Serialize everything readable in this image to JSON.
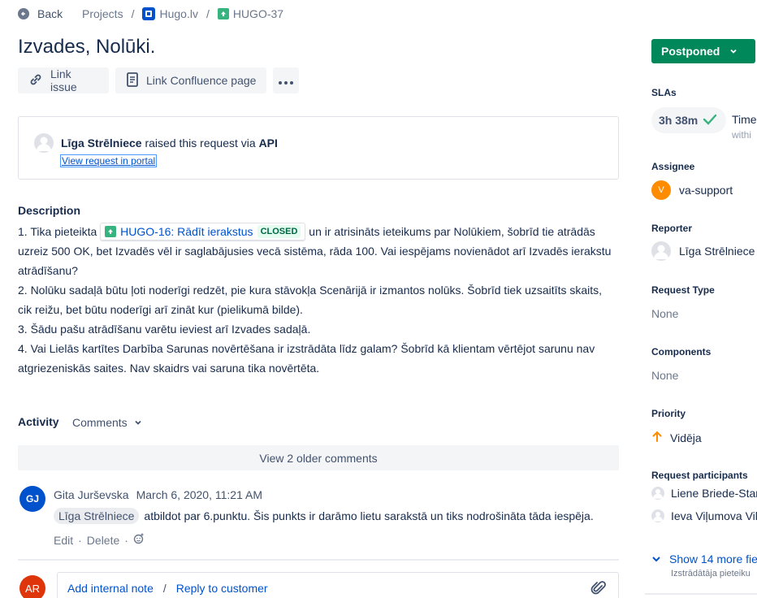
{
  "nav": {
    "back_label": "Back",
    "breadcrumbs": [
      "Projects",
      "Hugo.lv",
      "HUGO-37"
    ],
    "separator": "/"
  },
  "issue": {
    "title": "Izvades, Nolūki.",
    "status": "Postponed"
  },
  "actions": {
    "link_issue": "Link issue",
    "link_confluence": "Link Confluence page"
  },
  "request": {
    "raiser": "Līga Strēlniece",
    "raised_text": "raised this request via",
    "channel": "API",
    "portal_link": "View request in portal"
  },
  "description": {
    "heading": "Description",
    "p1_before": "1. Tika pieteikta ",
    "linked_issue": "HUGO-16: Rādīt ierakstus",
    "linked_status": "CLOSED",
    "p1_after": " un ir atrisināts ieteikums par Nolūkiem, šobrīd tie atrādās uzreiz 500 OK, bet Izvadēs vēl ir saglabājusies vecā sistēma, rāda 100. Vai iespējams novienādot arī Izvadēs ierakstu atrādīšanu?",
    "p2": "2. Nolūku sadaļā būtu ļoti noderīgi redzēt, pie kura stāvokļa Scenārijā ir izmantos nolūks. Šobrīd tiek uzsaitīts skaits, cik reižu, bet būtu noderīgi arī zināt kur (pielikumā bilde).",
    "p3": "3. Šādu pašu atrādīšanu varētu ieviest arī Izvades sadaļā.",
    "p4": "4. Vai Lielās kartītes Darbība Sarunas novērtēšana ir izstrādāta līdz galam? Šobrīd kā klientam vērtējot sarunu nav atgriezeniskās saites. Nav skaidrs vai saruna tika novērtēta."
  },
  "activity": {
    "heading": "Activity",
    "filter": "Comments",
    "older_comments": "View 2 older comments",
    "comment": {
      "initials": "GJ",
      "author": "Gita Jurševska",
      "timestamp": "March 6, 2020, 11:21 AM",
      "mention": "Līga Strēlniece",
      "text": "atbildot par 6.punktu. Šis punkts ir darāmo lietu sarakstā un tiks nodrošināta tāda iespēja.",
      "edit": "Edit",
      "delete": "Delete",
      "dot": "·"
    },
    "composer": {
      "initials": "AR",
      "add_internal": "Add internal note",
      "separator": "/",
      "reply": "Reply to customer"
    }
  },
  "sidebar": {
    "slas_label": "SLAs",
    "sla_value": "3h 38m",
    "sla_title": "Time",
    "sla_sub": "withi",
    "assignee_label": "Assignee",
    "assignee_initial": "V",
    "assignee": "va-support",
    "reporter_label": "Reporter",
    "reporter": "Līga Strēlniece",
    "request_type_label": "Request Type",
    "request_type": "None",
    "components_label": "Components",
    "components": "None",
    "priority_label": "Priority",
    "priority": "Vidēja",
    "participants_label": "Request participants",
    "participants": [
      "Liene Briede-Stare",
      "Ieva Viļumova Vil"
    ],
    "show_more": "Show 14 more fie",
    "show_more_sub": "Izstrādātāja pieteiku"
  },
  "colors": {
    "primary_link": "#0052cc",
    "status_green": "#00875a",
    "closed_bg": "#e3fcef",
    "priority_orange": "#ff8b00"
  }
}
